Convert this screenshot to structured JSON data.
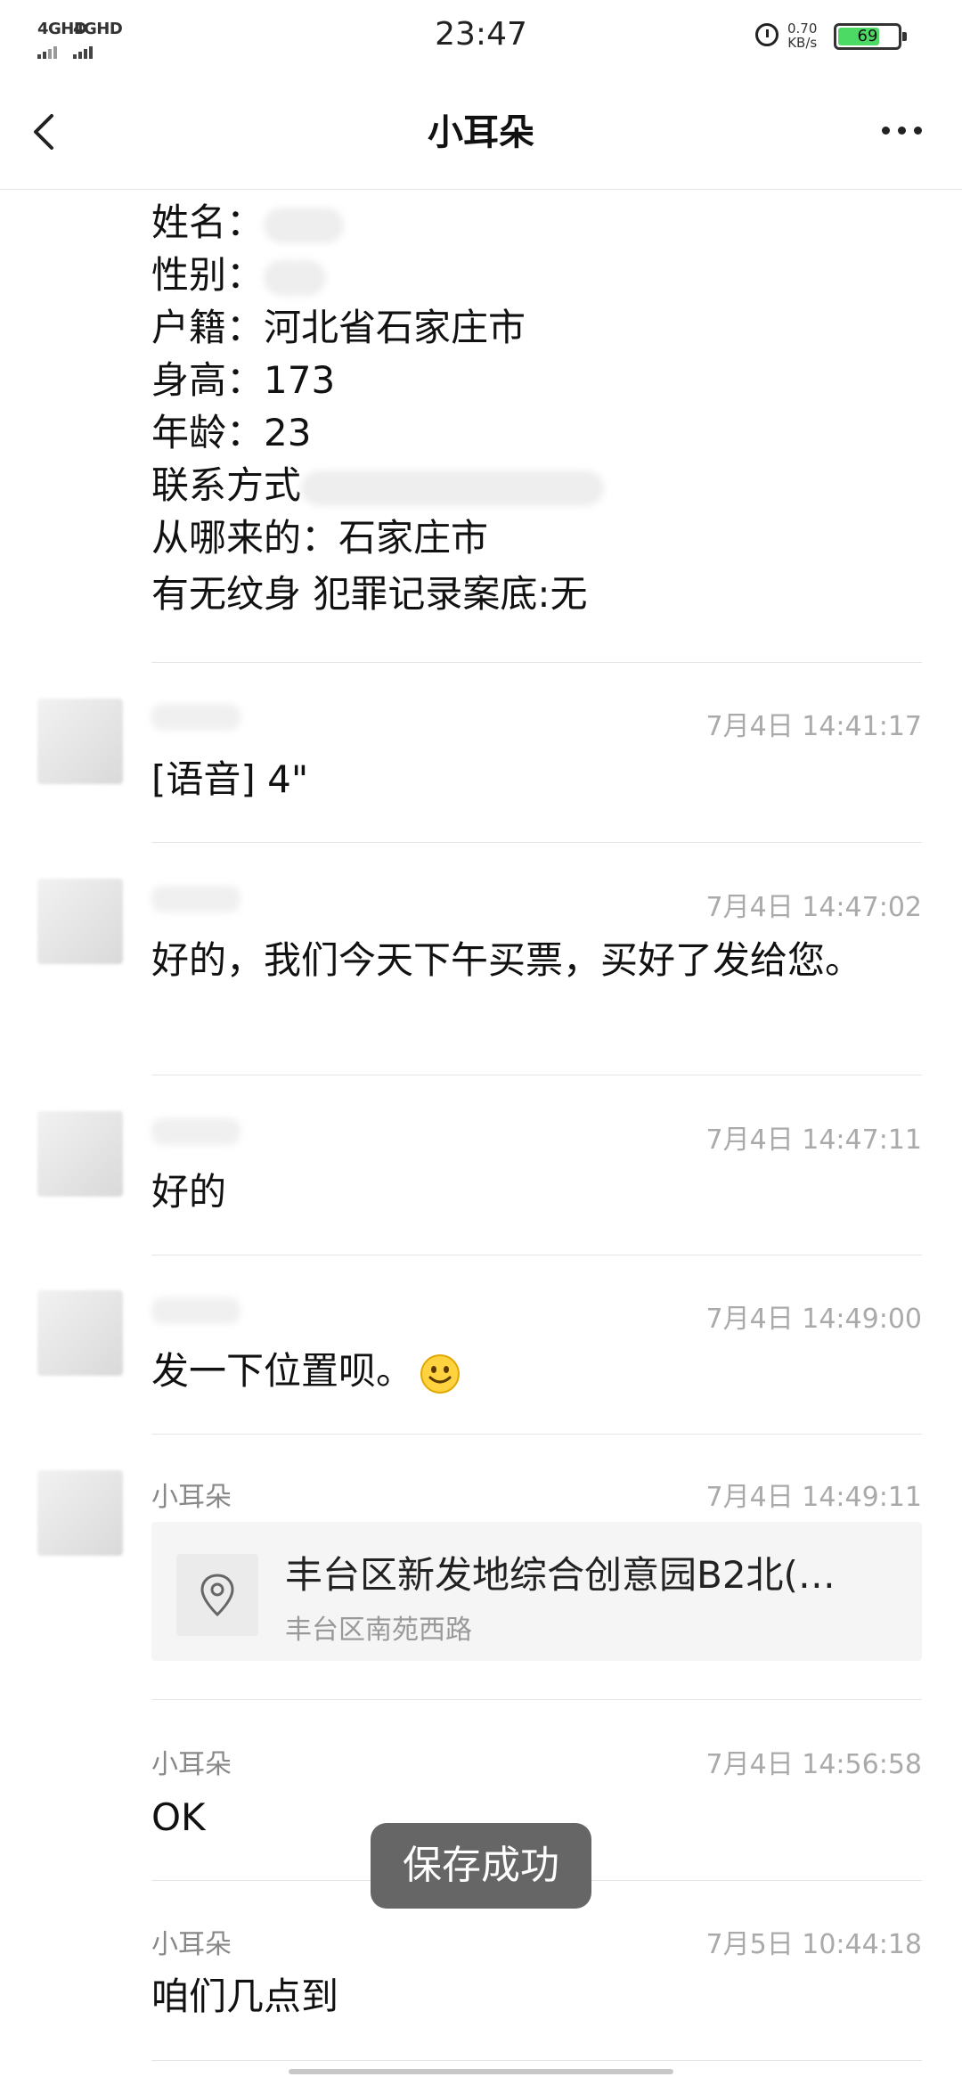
{
  "status_bar": {
    "signal_1": "4GHD",
    "signal_2": "4GHD",
    "time": "23:47",
    "net_speed_value": "0.70",
    "net_speed_unit": "KB/s",
    "battery_level": "69",
    "battery_fraction": 0.69,
    "alarm_icon": "alarm-clock-icon"
  },
  "header": {
    "back_icon": "chevron-left-icon",
    "title": "小耳朵",
    "more_icon": "more-dots-icon"
  },
  "info": {
    "name_label": "姓名：",
    "gender_label": "性别：",
    "hukou_label": "户籍：",
    "hukou_value": "河北省石家庄市",
    "height_label": "身高：",
    "height_value": "173",
    "age_label": "年龄：",
    "age_value": "23",
    "contact_label": "联系方式",
    "from_label": "从哪来的：",
    "from_value": "石家庄市",
    "tattoo_line": "有无纹身 犯罪记录案底:无"
  },
  "messages": [
    {
      "sender": "",
      "time": "7月4日 14:41:17",
      "text": "[语音] 4\""
    },
    {
      "sender": "",
      "time": "7月4日 14:47:02",
      "text": "好的，我们今天下午买票，买好了发给您。"
    },
    {
      "sender": "",
      "time": "7月4日 14:47:11",
      "text": "好的"
    },
    {
      "sender": "",
      "time": "7月4日 14:49:00",
      "text": "发一下位置呗。",
      "emoji": "smile-emoji-icon"
    },
    {
      "sender": "小耳朵",
      "time": "7月4日 14:49:11",
      "location": {
        "title": "丰台区新发地综合创意园B2北(…",
        "subtitle": "丰台区南苑西路",
        "icon": "location-pin-icon"
      }
    },
    {
      "sender": "小耳朵",
      "time": "7月4日 14:56:58",
      "text": "OK"
    },
    {
      "sender": "小耳朵",
      "time": "7月5日 10:44:18",
      "text": "咱们几点到"
    }
  ],
  "toast": {
    "text": "保存成功"
  }
}
